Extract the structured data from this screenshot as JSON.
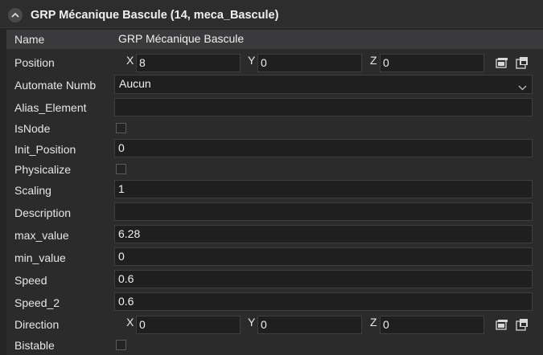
{
  "panel": {
    "title": "GRP Mécanique Bascule (14, meca_Bascule)"
  },
  "icons": {
    "collapse": "chevron-up-icon",
    "window": "window-icon",
    "copy": "copy-icon",
    "dropdown": "chevron-down-icon"
  },
  "rows": {
    "name": {
      "label": "Name",
      "value": "GRP Mécanique Bascule"
    },
    "position": {
      "label": "Position",
      "x_label": "X",
      "x": "8",
      "y_label": "Y",
      "y": "0",
      "z_label": "Z",
      "z": "0"
    },
    "automate": {
      "label": "Automate Numb",
      "value": "Aucun"
    },
    "alias": {
      "label": "Alias_Element",
      "value": ""
    },
    "isnode": {
      "label": "IsNode",
      "checked": false
    },
    "init_position": {
      "label": "Init_Position",
      "value": "0"
    },
    "physicalize": {
      "label": "Physicalize",
      "checked": false
    },
    "scaling": {
      "label": "Scaling",
      "value": "1"
    },
    "description": {
      "label": "Description",
      "value": ""
    },
    "max_value": {
      "label": "max_value",
      "value": "6.28"
    },
    "min_value": {
      "label": "min_value",
      "value": "0"
    },
    "speed": {
      "label": "Speed",
      "value": "0.6"
    },
    "speed_2": {
      "label": "Speed_2",
      "value": "0.6"
    },
    "direction": {
      "label": "Direction",
      "x_label": "X",
      "x": "0",
      "y_label": "Y",
      "y": "0",
      "z_label": "Z",
      "z": "0"
    },
    "bistable": {
      "label": "Bistable",
      "checked": false
    }
  },
  "colors": {
    "background": "#252526",
    "grid": "#2b2b2c",
    "field": "#1f1f20",
    "selected_row": "#3a3a3c"
  }
}
